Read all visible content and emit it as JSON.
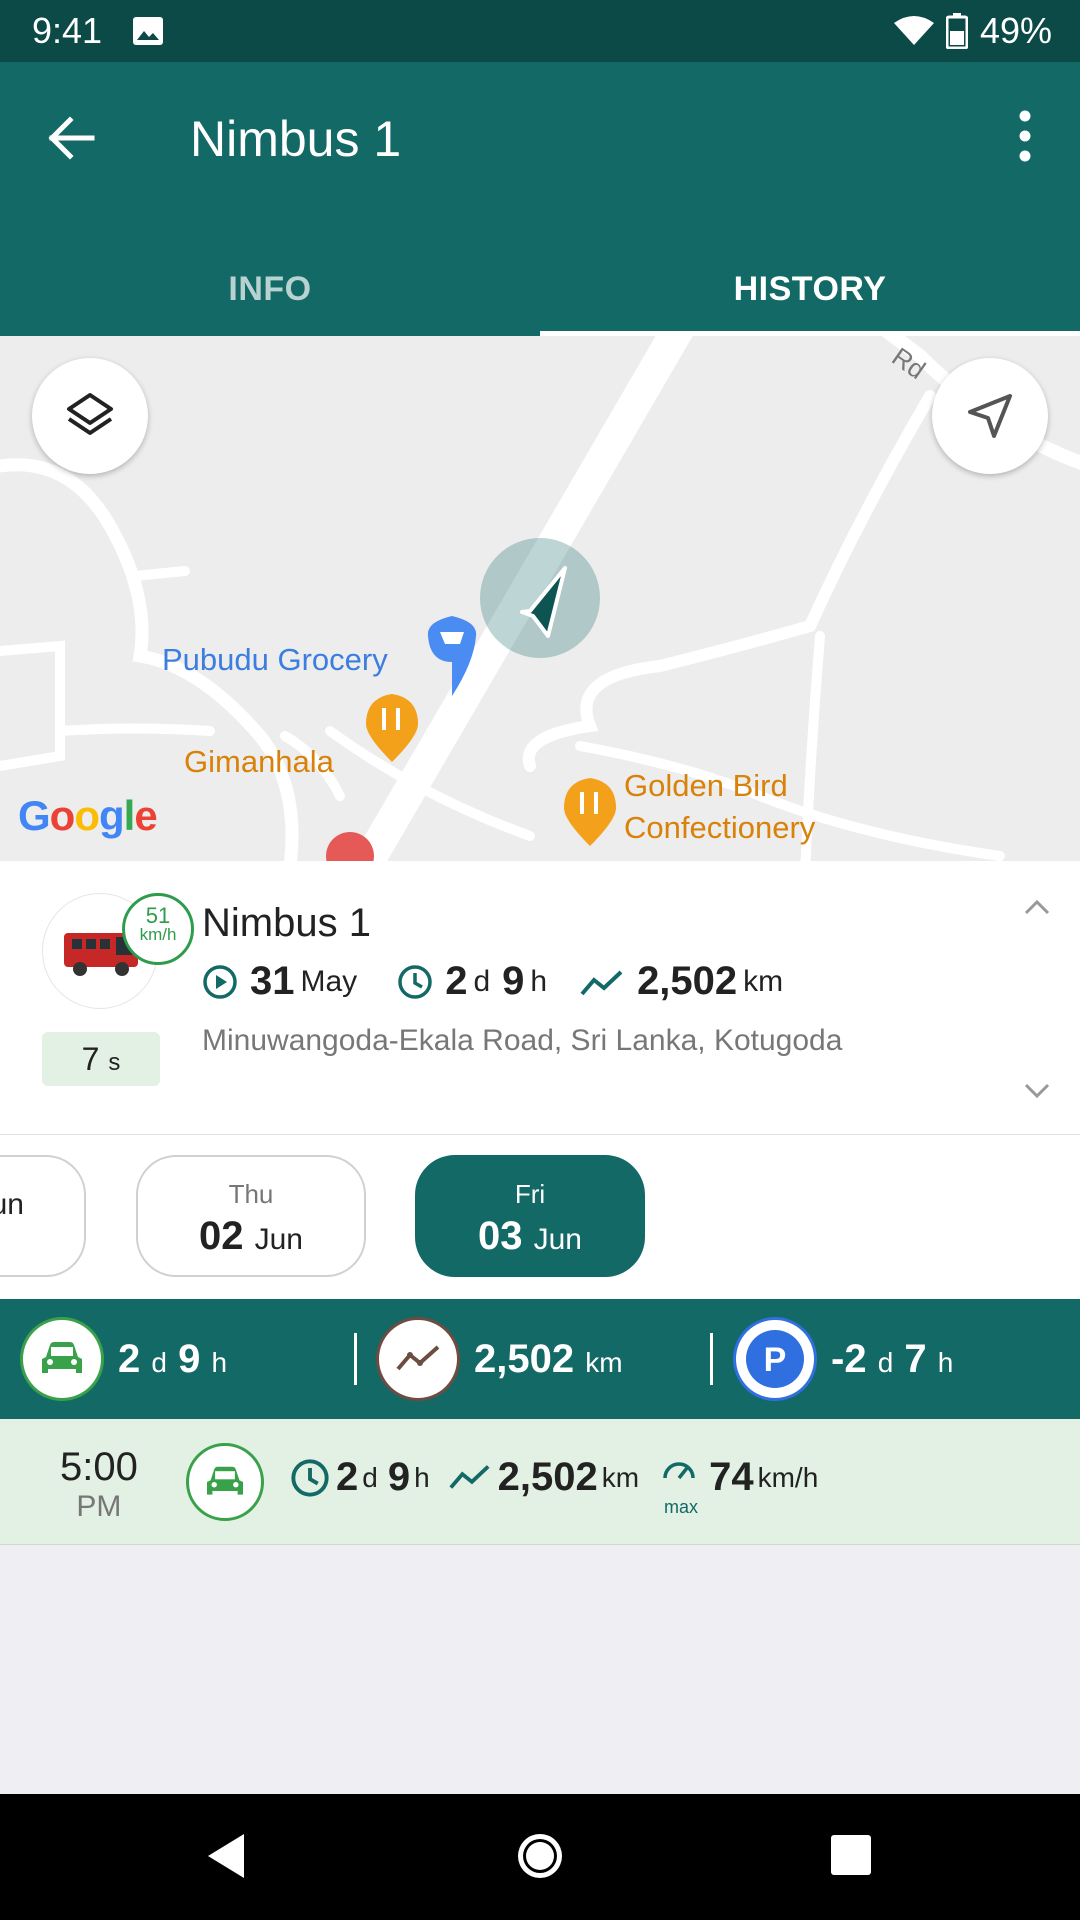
{
  "status_bar": {
    "time": "9:41",
    "battery": "49%"
  },
  "app_bar": {
    "title": "Nimbus 1"
  },
  "tabs": [
    {
      "label": "INFO",
      "active": false
    },
    {
      "label": "HISTORY",
      "active": true
    }
  ],
  "map": {
    "pois": [
      {
        "name": "Pubudu Grocery",
        "icon": "cart-pin-icon"
      },
      {
        "name": "Gimanhala",
        "icon": "restaurant-pin-icon"
      },
      {
        "name": "Golden Bird",
        "icon": "restaurant-pin-icon"
      },
      {
        "name": "Confectionery",
        "icon": ""
      }
    ],
    "road_label": "Rd",
    "attribution": "Google"
  },
  "vehicle": {
    "name": "Nimbus 1",
    "speed_value": "51",
    "speed_unit": "km/h",
    "last_update_value": "7",
    "last_update_unit": "s",
    "start_day": "31",
    "start_month": "May",
    "duration_days": "2",
    "duration_days_unit": "d",
    "duration_hours": "9",
    "duration_hours_unit": "h",
    "distance": "2,502",
    "distance_unit": "km",
    "address": "Minuwangoda-Ekala Road, Sri Lanka, Kotugoda"
  },
  "dates": [
    {
      "dow": "",
      "day": "",
      "month": "un",
      "active": false
    },
    {
      "dow": "Thu",
      "day": "02",
      "month": "Jun",
      "active": false
    },
    {
      "dow": "Fri",
      "day": "03",
      "month": "Jun",
      "active": true
    }
  ],
  "summary": {
    "drive_days": "2",
    "drive_days_unit": "d",
    "drive_hours": "9",
    "drive_hours_unit": "h",
    "distance": "2,502",
    "distance_unit": "km",
    "parking_days": "-2",
    "parking_days_unit": "d",
    "parking_hours": "7",
    "parking_hours_unit": "h",
    "parking_letter": "P"
  },
  "trips": [
    {
      "time": "5:00",
      "ampm": "PM",
      "duration_days": "2",
      "duration_days_unit": "d",
      "duration_hours": "9",
      "duration_hours_unit": "h",
      "distance": "2,502",
      "distance_unit": "km",
      "max_label": "max",
      "max_speed": "74",
      "max_speed_unit": "km/h"
    }
  ],
  "colors": {
    "primary": "#136966",
    "status_bar": "#0b4a47",
    "green": "#3aa14b",
    "parking_blue": "#2f6fe0",
    "distance_brown": "#6d4c41"
  }
}
